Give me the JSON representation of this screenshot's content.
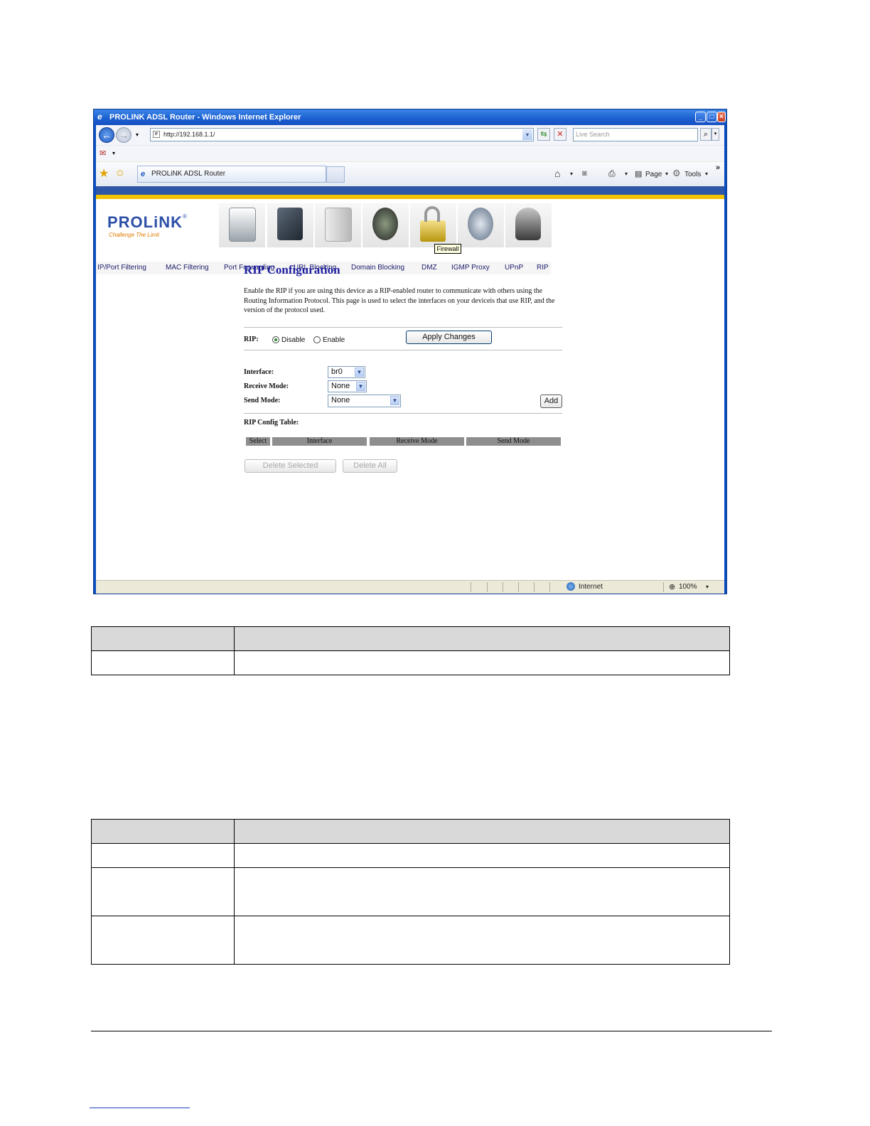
{
  "window": {
    "title": "PROLINK ADSL Router - Windows Internet Explorer",
    "address": "http://192.168.1.1/",
    "search_placeholder": "Live Search",
    "tab_label": "PROLiNK ADSL Router",
    "commands": {
      "page": "Page",
      "tools": "Tools"
    },
    "status_zone": "Internet",
    "zoom": "100%"
  },
  "router": {
    "logo": "PROLiNK",
    "tagline": "Challenge The Limit",
    "tooltip": "Firewall",
    "menu": [
      "IP/Port Filtering",
      "MAC Filtering",
      "Port Forwarding",
      "URL Blocking",
      "Domain Blocking",
      "DMZ",
      "IGMP Proxy",
      "UPnP",
      "RIP"
    ]
  },
  "rip": {
    "title": "RIP Configuration",
    "description": "Enable the RIP if you are using this device as a RIP-enabled router to communicate with others using the Routing Information Protocol. This page is used to select the interfaces on your deviceis that use RIP, and the version of the protocol used.",
    "rip_label": "RIP:",
    "disable_label": "Disable",
    "enable_label": "Enable",
    "apply_button": "Apply Changes",
    "interface_label": "Interface:",
    "interface_value": "br0",
    "receive_label": "Receive Mode:",
    "receive_value": "None",
    "send_label": "Send Mode:",
    "send_value": "None",
    "add_button": "Add",
    "table_label": "RIP Config Table:",
    "columns": [
      "Select",
      "Interface",
      "Receive Mode",
      "Send Mode"
    ],
    "delete_selected": "Delete Selected",
    "delete_all": "Delete All"
  },
  "colors": {
    "title_blue": "#1e1ea0",
    "menu_navy": "#1a1a6a",
    "header_gray": "#8e8e8e"
  }
}
